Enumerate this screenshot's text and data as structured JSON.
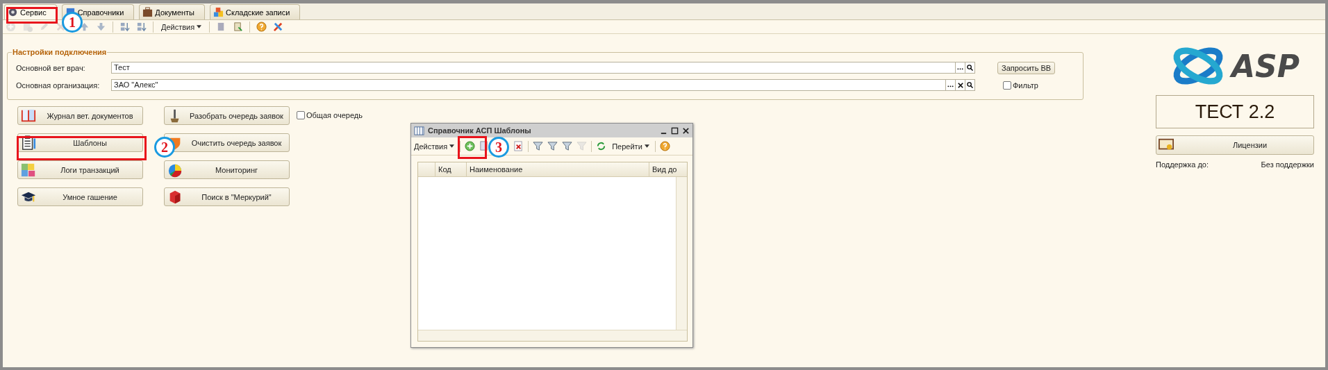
{
  "tabs": [
    {
      "label": "Сервис",
      "selected": true,
      "kind": "gear"
    },
    {
      "label": "Справочники",
      "selected": false,
      "kind": "book"
    },
    {
      "label": "Документы",
      "selected": false,
      "kind": "case"
    },
    {
      "label": "Складские записи",
      "selected": false,
      "kind": "boxes"
    }
  ],
  "toolbar": {
    "actions_label": "Действия"
  },
  "settings": {
    "title": "Настройки подключения",
    "fields": [
      {
        "label": "Основной вет врач:",
        "value": "Тест",
        "clearable": false
      },
      {
        "label": "Основная организация:",
        "value": "ЗАО \"Алекс\"",
        "clearable": true
      }
    ],
    "request_button": "Запросить ВВ",
    "filter": {
      "label": "Фильтр",
      "checked": false
    }
  },
  "buttons": [
    {
      "label": "Журнал вет. документов",
      "kind": "book"
    },
    {
      "label": "Шаблоны",
      "kind": "clipboard"
    },
    {
      "label": "Логи транзакций",
      "kind": "puzzle"
    },
    {
      "label": "Умное гашение",
      "kind": "cap"
    },
    {
      "label": "Разобрать очередь заявок",
      "kind": "shovel"
    },
    {
      "label": "Очистить очередь заявок",
      "kind": "shield"
    },
    {
      "label": "Мониторинг",
      "kind": "pie"
    },
    {
      "label": "Поиск в \"Меркурий\"",
      "kind": "cube"
    }
  ],
  "common_queue": {
    "label": "Общая очередь",
    "checked": false
  },
  "dialog": {
    "title": "Справочник АСП Шаблоны",
    "actions_label": "Действия",
    "goto_label": "Перейти",
    "columns": [
      "Код",
      "Наименование",
      "Вид до"
    ]
  },
  "brand": {
    "logo_text": "ASP",
    "version": "ТЕСТ 2.2",
    "license_button": "Лицензии",
    "support_label": "Поддержка до:",
    "support_value": "Без поддержки"
  },
  "annotations": [
    {
      "number": "1"
    },
    {
      "number": "2"
    },
    {
      "number": "3"
    }
  ]
}
